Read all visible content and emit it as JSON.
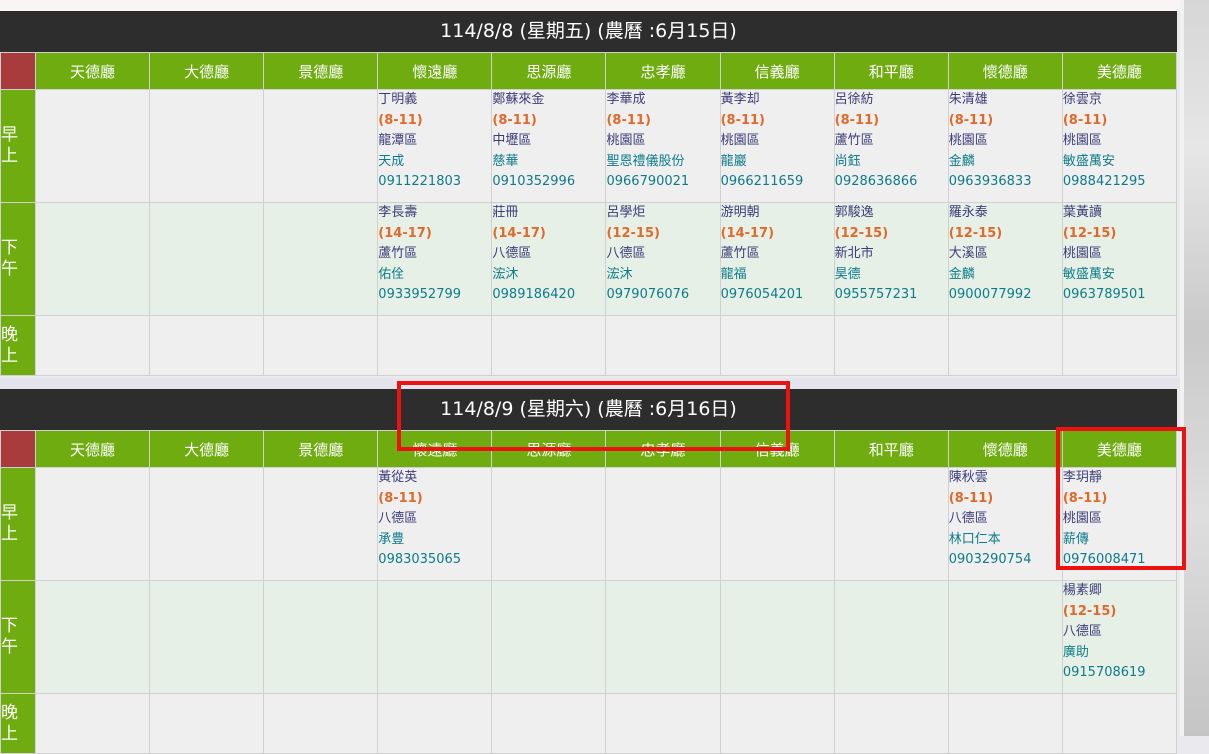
{
  "days": [
    {
      "date_label": "114/8/8 (星期五) (農曆 :6月15日)",
      "halls": [
        "天德廳",
        "大德廳",
        "景德廳",
        "懷遠廳",
        "思源廳",
        "忠孝廳",
        "信義廳",
        "和平廳",
        "懷德廳",
        "美德廳"
      ],
      "periods": [
        {
          "label": "早\n上",
          "cells": [
            null,
            null,
            null,
            {
              "name": "丁明義",
              "time": "(8-11)",
              "district": "龍潭區",
              "company": "天成",
              "phone": "0911221803"
            },
            {
              "name": "鄭蘇來金",
              "time": "(8-11)",
              "district": "中壢區",
              "company": "慈華",
              "phone": "0910352996"
            },
            {
              "name": "李華成",
              "time": "(8-11)",
              "district": "桃園區",
              "company": "聖恩禮儀股份",
              "phone": "0966790021"
            },
            {
              "name": "黃李却",
              "time": "(8-11)",
              "district": "桃園區",
              "company": "龍巖",
              "phone": "0966211659"
            },
            {
              "name": "呂徐紡",
              "time": "(8-11)",
              "district": "蘆竹區",
              "company": "尚鈺",
              "phone": "0928636866"
            },
            {
              "name": "朱清雄",
              "time": "(8-11)",
              "district": "桃園區",
              "company": "金麟",
              "phone": "0963936833"
            },
            {
              "name": "徐雲京",
              "time": "(8-11)",
              "district": "桃園區",
              "company": "敏盛萬安",
              "phone": "0988421295"
            }
          ]
        },
        {
          "label": "下\n午",
          "cells": [
            null,
            null,
            null,
            {
              "name": "李長壽",
              "time": "(14-17)",
              "district": "蘆竹區",
              "company": "佑佺",
              "phone": "0933952799"
            },
            {
              "name": "莊冊",
              "time": "(14-17)",
              "district": "八德區",
              "company": "浤沐",
              "phone": "0989186420"
            },
            {
              "name": "呂學炬",
              "time": "(12-15)",
              "district": "八德區",
              "company": "浤沐",
              "phone": "0979076076"
            },
            {
              "name": "游明朝",
              "time": "(14-17)",
              "district": "蘆竹區",
              "company": "龍福",
              "phone": "0976054201"
            },
            {
              "name": "郭駿逸",
              "time": "(12-15)",
              "district": "新北市",
              "company": "昊德",
              "phone": "0955757231"
            },
            {
              "name": "羅永泰",
              "time": "(12-15)",
              "district": "大溪區",
              "company": "金麟",
              "phone": "0900077992"
            },
            {
              "name": "葉黃讀",
              "time": "(12-15)",
              "district": "桃園區",
              "company": "敏盛萬安",
              "phone": "0963789501"
            }
          ]
        },
        {
          "label": "晚\n上",
          "cells": [
            null,
            null,
            null,
            null,
            null,
            null,
            null,
            null,
            null,
            null
          ]
        }
      ]
    },
    {
      "date_label": "114/8/9 (星期六) (農曆 :6月16日)",
      "halls": [
        "天德廳",
        "大德廳",
        "景德廳",
        "懷遠廳",
        "思源廳",
        "忠孝廳",
        "信義廳",
        "和平廳",
        "懷德廳",
        "美德廳"
      ],
      "periods": [
        {
          "label": "早\n上",
          "cells": [
            null,
            null,
            null,
            {
              "name": "黃從英",
              "time": "(8-11)",
              "district": "八德區",
              "company": "承豊",
              "phone": "0983035065"
            },
            null,
            null,
            null,
            null,
            {
              "name": "陳秋雲",
              "time": "(8-11)",
              "district": "八德區",
              "company": "林口仁本",
              "phone": "0903290754"
            },
            {
              "name": "李玥靜",
              "time": "(8-11)",
              "district": "桃園區",
              "company": "薪傳",
              "phone": "0976008471"
            }
          ]
        },
        {
          "label": "下\n午",
          "cells": [
            null,
            null,
            null,
            null,
            null,
            null,
            null,
            null,
            null,
            {
              "name": "楊素卿",
              "time": "(12-15)",
              "district": "八德區",
              "company": "廣助",
              "phone": "0915708619"
            }
          ]
        },
        {
          "label": "晚\n上",
          "cells": [
            null,
            null,
            null,
            null,
            null,
            null,
            null,
            null,
            null,
            null
          ]
        }
      ]
    }
  ]
}
